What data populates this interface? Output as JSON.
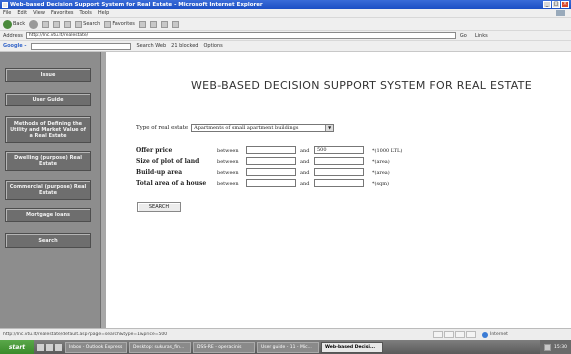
{
  "window": {
    "title": "Web-based Decision Support System for Real Estate - Microsoft Internet Explorer",
    "controls": [
      "_",
      "□",
      "×"
    ]
  },
  "menu": [
    "File",
    "Edit",
    "View",
    "Favorites",
    "Tools",
    "Help"
  ],
  "toolbar": {
    "back": "Back",
    "search": "Search",
    "favorites": "Favorites"
  },
  "address": {
    "label": "Address",
    "url": "http://lnc.vtu.lt/realestate/",
    "go": "Go",
    "links": "Links"
  },
  "google": {
    "logo": "Google -",
    "search_web": "Search Web",
    "blocked": "21 blocked",
    "options": "Options"
  },
  "sidebar": {
    "items": [
      {
        "label": "Issue"
      },
      {
        "label": "User Guide"
      },
      {
        "label": "Methods of Defining the Utility and Market Value of a Real Estate"
      },
      {
        "label": "Dwelling (purpose) Real Estate"
      },
      {
        "label": "Commercial (purpose) Real Estate"
      },
      {
        "label": "Mortgage loans"
      },
      {
        "label": "Search"
      }
    ]
  },
  "main": {
    "title": "WEB-BASED DECISION SUPPORT SYSTEM FOR REAL ESTATE",
    "type_label": "Type of real estate",
    "type_value": "Apartments of small apartment buildings",
    "criteria": [
      {
        "label": "Offer price",
        "between": "between",
        "from": "",
        "and": "and",
        "to": "500",
        "unit": "*(1000 LTL)"
      },
      {
        "label": "Size of plot of land",
        "between": "between",
        "from": "",
        "and": "and",
        "to": "",
        "unit": "*(area)"
      },
      {
        "label": "Build-up area",
        "between": "between",
        "from": "",
        "and": "and",
        "to": "",
        "unit": "*(area)"
      },
      {
        "label": "Total area of a house",
        "between": "between",
        "from": "",
        "and": "and",
        "to": "",
        "unit": "*(sqm)"
      }
    ],
    "search_button": "SEARCH"
  },
  "status": {
    "url": "http://lnc.vtu.lt/realestate/default.asp?page=search&type=1&price=500",
    "zone": "Internet"
  },
  "taskbar": {
    "start": "start",
    "tasks": [
      {
        "label": "Inbox - Outlook Express",
        "active": false
      },
      {
        "label": "Desktop: sukuras_fin...",
        "active": false
      },
      {
        "label": "DSS-RE - operacinis",
        "active": false
      },
      {
        "label": "User guide - 11 - Mic...",
        "active": false
      },
      {
        "label": "Web-based Decisi...",
        "active": true
      }
    ],
    "clock": "15:30"
  }
}
